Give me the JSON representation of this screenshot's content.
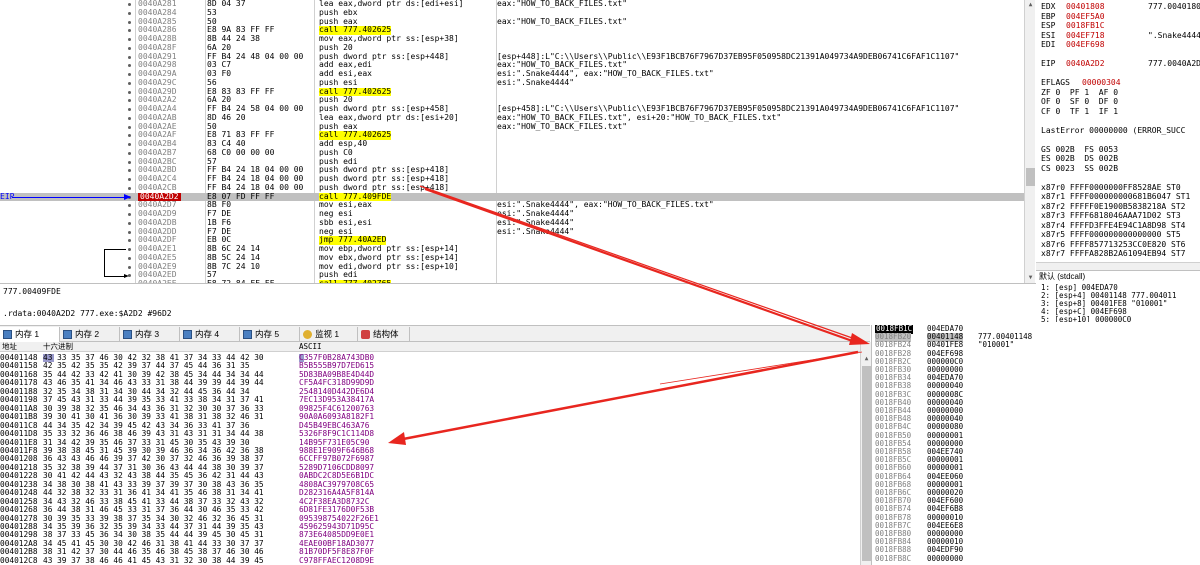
{
  "disasm": {
    "rows": [
      {
        "addr": "0040A281",
        "bytes": "8D 04 37",
        "instr": "lea eax,dword ptr ds:[edi+esi]",
        "cmt": "eax:\"HOW_TO_BACK_FILES.txt\""
      },
      {
        "addr": "0040A284",
        "bytes": "53",
        "instr": "push ebx",
        "cmt": ""
      },
      {
        "addr": "0040A285",
        "bytes": "50",
        "instr": "push eax",
        "cmt": "eax:\"HOW_TO_BACK_FILES.txt\""
      },
      {
        "addr": "0040A286",
        "bytes": "E8 9A 83 FF FF",
        "instr": "call 777.402625",
        "cmt": "",
        "call": true
      },
      {
        "addr": "0040A28B",
        "bytes": "8B 44 24 38",
        "instr": "mov eax,dword ptr ss:[esp+38]",
        "cmt": "",
        "reg": true
      },
      {
        "addr": "0040A28F",
        "bytes": "6A 20",
        "instr": "push 20",
        "cmt": ""
      },
      {
        "addr": "0040A291",
        "bytes": "FF B4 24 48 04 00 00",
        "instr": "push dword ptr ss:[esp+448]",
        "cmt": "[esp+448]:L\"C:\\\\Users\\\\Public\\\\E93F1BCB76F7967D37EB95F050958DC21391A049734A9DEB06741C6FAF1C1107\"",
        "reg": true
      },
      {
        "addr": "0040A298",
        "bytes": "03 C7",
        "instr": "add eax,edi",
        "cmt": "eax:\"HOW_TO_BACK_FILES.txt\""
      },
      {
        "addr": "0040A29A",
        "bytes": "03 F0",
        "instr": "add esi,eax",
        "cmt": "esi:\".Snake4444\", eax:\"HOW_TO_BACK_FILES.txt\""
      },
      {
        "addr": "0040A29C",
        "bytes": "56",
        "instr": "push esi",
        "cmt": "esi:\".Snake4444\""
      },
      {
        "addr": "0040A29D",
        "bytes": "E8 83 83 FF FF",
        "instr": "call 777.402625",
        "cmt": "",
        "call": true
      },
      {
        "addr": "0040A2A2",
        "bytes": "6A 20",
        "instr": "push 20",
        "cmt": ""
      },
      {
        "addr": "0040A2A4",
        "bytes": "FF B4 24 58 04 00 00",
        "instr": "push dword ptr ss:[esp+458]",
        "cmt": "[esp+458]:L\"C:\\\\Users\\\\Public\\\\E93F1BCB76F7967D37EB95F050958DC21391A049734A9DEB06741C6FAF1C1107\"",
        "reg": true
      },
      {
        "addr": "0040A2AB",
        "bytes": "8D 46 20",
        "instr": "lea eax,dword ptr ds:[esi+20]",
        "cmt": "eax:\"HOW_TO_BACK_FILES.txt\", esi+20:\"HOW_TO_BACK_FILES.txt\""
      },
      {
        "addr": "0040A2AE",
        "bytes": "50",
        "instr": "push eax",
        "cmt": "eax:\"HOW_TO_BACK_FILES.txt\""
      },
      {
        "addr": "0040A2AF",
        "bytes": "E8 71 83 FF FF",
        "instr": "call 777.402625",
        "cmt": "",
        "call": true
      },
      {
        "addr": "0040A2B4",
        "bytes": "83 C4 40",
        "instr": "add esp,40",
        "cmt": ""
      },
      {
        "addr": "0040A2B7",
        "bytes": "68 C0 00 00 00",
        "instr": "push C0",
        "cmt": ""
      },
      {
        "addr": "0040A2BC",
        "bytes": "57",
        "instr": "push edi",
        "cmt": ""
      },
      {
        "addr": "0040A2BD",
        "bytes": "FF B4 24 18 04 00 00",
        "instr": "push dword ptr ss:[esp+418]",
        "cmt": "",
        "reg": true
      },
      {
        "addr": "0040A2C4",
        "bytes": "FF B4 24 18 04 00 00",
        "instr": "push dword ptr ss:[esp+418]",
        "cmt": "",
        "reg": true
      },
      {
        "addr": "0040A2CB",
        "bytes": "FF B4 24 18 04 00 00",
        "instr": "push dword ptr ss:[esp+418]",
        "cmt": "",
        "reg": true
      },
      {
        "addr": "0040A2D2",
        "bytes": "E8 07 FD FF FF",
        "instr": "call 777.409FDE",
        "cmt": "",
        "call": true,
        "current": true
      },
      {
        "addr": "0040A2D7",
        "bytes": "8B F0",
        "instr": "mov esi,eax",
        "cmt": "esi:\".Snake4444\", eax:\"HOW_TO_BACK_FILES.txt\""
      },
      {
        "addr": "0040A2D9",
        "bytes": "F7 DE",
        "instr": "neg esi",
        "cmt": "esi:\".Snake4444\""
      },
      {
        "addr": "0040A2DB",
        "bytes": "1B F6",
        "instr": "sbb esi,esi",
        "cmt": "esi:\".Snake4444\""
      },
      {
        "addr": "0040A2DD",
        "bytes": "F7 DE",
        "instr": "neg esi",
        "cmt": "esi:\".Snake4444\""
      },
      {
        "addr": "0040A2DF",
        "bytes": "EB 0C",
        "instr": "jmp 777.40A2ED",
        "cmt": "",
        "jmp": true
      },
      {
        "addr": "0040A2E1",
        "bytes": "8B 6C 24 14",
        "instr": "mov ebp,dword ptr ss:[esp+14]",
        "cmt": "",
        "reg": true
      },
      {
        "addr": "0040A2E5",
        "bytes": "8B 5C 24 14",
        "instr": "mov ebx,dword ptr ss:[esp+14]",
        "cmt": "",
        "reg": true
      },
      {
        "addr": "0040A2E9",
        "bytes": "8B 7C 24 10",
        "instr": "mov edi,dword ptr ss:[esp+10]",
        "cmt": "",
        "reg": true
      },
      {
        "addr": "0040A2ED",
        "bytes": "57",
        "instr": "push edi",
        "cmt": ""
      },
      {
        "addr": "0040A2EE",
        "bytes": "E8 72 84 FF FF",
        "instr": "call 777.402765",
        "cmt": "",
        "call": true
      },
      {
        "addr": "0040A2F3",
        "bytes": "55",
        "instr": "push ebp",
        "cmt": ""
      }
    ],
    "ip_label": "EIP"
  },
  "registers": {
    "lines": [
      {
        "name": "EDX",
        "val": "00401808",
        "extra": "777.0040180"
      },
      {
        "name": "EBP",
        "val": "004EF5A0",
        "extra": ""
      },
      {
        "name": "ESP",
        "val": "0018FB1C",
        "extra": ""
      },
      {
        "name": "ESI",
        "val": "004EF718",
        "extra": "\".Snake4444"
      },
      {
        "name": "EDI",
        "val": "004EF698",
        "extra": ""
      },
      {
        "name": "",
        "val": "",
        "extra": ""
      },
      {
        "name": "EIP",
        "val": "0040A2D2",
        "extra": "777.0040A2D"
      },
      {
        "name": "",
        "val": "",
        "extra": ""
      },
      {
        "name": "EFLAGS",
        "val": "00000304",
        "extra": ""
      },
      {
        "name": "ZF 0  PF 1  AF 0",
        "val": "",
        "extra": ""
      },
      {
        "name": "OF 0  SF 0  DF 0",
        "val": "",
        "extra": ""
      },
      {
        "name": "CF 0  TF 1  IF 1",
        "val": "",
        "extra": ""
      },
      {
        "name": "",
        "val": "",
        "extra": ""
      },
      {
        "name": "LastError 00000000 (ERROR_SUCC",
        "val": "",
        "extra": ""
      },
      {
        "name": "",
        "val": "",
        "extra": ""
      },
      {
        "name": "GS 002B  FS 0053",
        "val": "",
        "extra": ""
      },
      {
        "name": "ES 002B  DS 002B",
        "val": "",
        "extra": ""
      },
      {
        "name": "CS 0023  SS 002B",
        "val": "",
        "extra": ""
      },
      {
        "name": "",
        "val": "",
        "extra": ""
      },
      {
        "name": "x87r0 FFFF0000000FF8528AE ST0",
        "val": "",
        "extra": ""
      },
      {
        "name": "x87r1 FFFF000000000681B6047 ST1",
        "val": "",
        "extra": ""
      },
      {
        "name": "x87r2 FFFFF0E1900B5838218A ST2",
        "val": "",
        "extra": ""
      },
      {
        "name": "x87r3 FFFF6818046AAA71D02 ST3",
        "val": "",
        "extra": ""
      },
      {
        "name": "x87r4 FFFFD3FFE4E94C1A8D98 ST4",
        "val": "",
        "extra": ""
      },
      {
        "name": "x87r5 FFFF000000000000000 ST5",
        "val": "",
        "extra": ""
      },
      {
        "name": "x87r6 FFFF857713253CC0E820 ST6",
        "val": "",
        "extra": ""
      },
      {
        "name": "x87r7 FFFFA828B2A61094EB94 ST7",
        "val": "",
        "extra": ""
      }
    ]
  },
  "callconv": {
    "title": "默认 (stdcall)",
    "lines": [
      "1: [esp] 004EDA70",
      "2: [esp+4] 00401148 777.004011",
      "3: [esp+8] 00401FE8 \"010001\"",
      "4: [esp+C] 004EF698",
      "5: [esp+10] 000000C0"
    ]
  },
  "status": {
    "line1": "777.00409FDE",
    "line2": ".rdata:0040A2D2 777.exe:$A2D2 #96D2"
  },
  "tabs": [
    {
      "label": "内存 1",
      "icon": "memory-icon",
      "active": true
    },
    {
      "label": "内存 2",
      "icon": "memory-icon",
      "active": false
    },
    {
      "label": "内存 3",
      "icon": "memory-icon",
      "active": false
    },
    {
      "label": "内存 4",
      "icon": "memory-icon",
      "active": false
    },
    {
      "label": "内存 5",
      "icon": "memory-icon",
      "active": false
    },
    {
      "label": "监视 1",
      "icon": "watch-icon",
      "active": false
    },
    {
      "label": "结构体",
      "icon": "struct-icon",
      "active": false
    }
  ],
  "dump": {
    "headers": {
      "addr": "地址",
      "hex": "十六进制",
      "ascii": "ASCII"
    },
    "rows": [
      {
        "addr": "00401148",
        "hex": "43 33 35 37 46 30 42 32 38 41 37 34 33 44 42 30",
        "asc": "C357F0B28A743DB0"
      },
      {
        "addr": "00401158",
        "hex": "42 35 42 35 35 42 39 37 44 37 45 44 36 31 35",
        "asc": "B5B555B97D7ED615"
      },
      {
        "addr": "00401168",
        "hex": "35 44 42 33 42 41 30 39 42 38 45 34 44 34 34 44",
        "asc": "5D83BA09B8E4D44D"
      },
      {
        "addr": "00401178",
        "hex": "43 46 35 41 34 46 43 33 31 38 44 39 39 44 39 44",
        "asc": "CF5A4FC318D99D9D"
      },
      {
        "addr": "00401188",
        "hex": "32 35 34 38 31 34 30 44 34 32 44 45 36 44 34",
        "asc": "2548140D442DE6D4"
      },
      {
        "addr": "00401198",
        "addr2": "",
        "hex": "37 45 43 31 33 44 39 35 33 41 33 38 34 31 37 41",
        "asc": "7EC13D953A38417A"
      },
      {
        "addr": "004011A8",
        "hex": "30 39 38 32 35 46 34 43 36 31 32 30 30 37 36 33",
        "asc": "09825F4C61200763"
      },
      {
        "addr": "004011B8",
        "hex": "39 30 41 30 41 36 30 39 33 41 38 31 38 32 46 31",
        "asc": "90A0A6093A8182F1"
      },
      {
        "addr": "004011C8",
        "hex": "44 34 35 42 34 39 45 42 43 34 36 33 41 37 36",
        "asc": "D45B49EBC463A76"
      },
      {
        "addr": "004011D8",
        "hex": "35 33 32 36 46 38 46 39 43 31 43 31 31 34 44 38",
        "asc": "5326F8F9C1C114D8"
      },
      {
        "addr": "004011E8",
        "hex": "31 34 42 39 35 46 37 33 31 45 30 35 43 39 30",
        "asc": "14B95F731E05C90"
      },
      {
        "addr": "004011F8",
        "hex": "39 38 38 45 31 45 39 30 39 46 36 34 36 42 36 38",
        "asc": "988E1E909F646B68"
      },
      {
        "addr": "00401208",
        "hex": "36 43 43 46 46 39 37 42 30 37 32 46 36 39 38 37",
        "asc": "6CCFF97B072F6987"
      },
      {
        "addr": "00401218",
        "hex": "35 32 38 39 44 37 31 30 36 43 44 44 38 30 39 37",
        "asc": "5289D7106CDD8097"
      },
      {
        "addr": "00401228",
        "hex": "30 41 42 44 43 32 43 38 44 35 45 36 42 31 44 43",
        "asc": "0ABDC2C8D5E6B1DC"
      },
      {
        "addr": "00401238",
        "hex": "34 38 30 38 41 43 33 39 37 39 37 30 38 43 36 35",
        "asc": "4808AC3979708C65"
      },
      {
        "addr": "00401248",
        "hex": "44 32 38 32 33 31 36 41 34 41 35 46 38 31 34 41",
        "asc": "D282316A4A5F814A"
      },
      {
        "addr": "00401258",
        "hex": "34 43 32 46 33 38 45 41 33 44 38 37 33 32 43 32",
        "asc": "4C2F38EA3D8732C"
      },
      {
        "addr": "00401268",
        "hex": "36 44 38 31 46 45 33 31 37 36 44 30 46 35 33 42",
        "asc": "6D81FE3176D0F53B"
      },
      {
        "addr": "00401278",
        "hex": "30 39 35 33 39 38 37 35 34 30 32 46 32 36 45 31",
        "asc": "095398754022F26E1"
      },
      {
        "addr": "00401288",
        "hex": "34 35 39 36 32 35 39 34 33 44 37 31 44 39 35 43",
        "asc": "459625943D71D95C"
      },
      {
        "addr": "00401298",
        "hex": "38 37 33 45 36 34 30 38 35 44 44 39 45 30 45 31",
        "asc": "873E64085DD9E0E1"
      },
      {
        "addr": "004012A8",
        "hex": "34 45 41 45 30 30 42 46 31 38 41 44 33 30 37 37",
        "asc": "4EAE00BF18AD3077"
      },
      {
        "addr": "004012B8",
        "hex": "38 31 42 37 30 44 46 35 46 38 45 38 37 46 30 46",
        "asc": "81B70DF5F8E87F0F"
      },
      {
        "addr": "004012C8",
        "hex": "43 39 37 38 46 46 41 45 43 31 32 30 38 44 39 45",
        "asc": "C978FFAEC1208D9E"
      }
    ]
  },
  "stack": {
    "rows": [
      {
        "addr": "0018FB1C",
        "val": "004EDA70",
        "cmt": "",
        "cur": true
      },
      {
        "addr": "0018FB20",
        "val": "00401148",
        "cmt": "777.00401148",
        "sel": true
      },
      {
        "addr": "0018FB24",
        "val": "00401FE8",
        "cmt": "\"010001\""
      },
      {
        "addr": "0018FB28",
        "val": "004EF698",
        "cmt": ""
      },
      {
        "addr": "0018FB2C",
        "val": "000000C0",
        "cmt": ""
      },
      {
        "addr": "0018FB30",
        "val": "00000000",
        "cmt": ""
      },
      {
        "addr": "0018FB34",
        "val": "004EDA70",
        "cmt": ""
      },
      {
        "addr": "0018FB38",
        "val": "00000040",
        "cmt": ""
      },
      {
        "addr": "0018FB3C",
        "val": "0000008C",
        "cmt": ""
      },
      {
        "addr": "0018FB40",
        "val": "00000040",
        "cmt": ""
      },
      {
        "addr": "0018FB44",
        "val": "00000000",
        "cmt": ""
      },
      {
        "addr": "0018FB48",
        "val": "00000040",
        "cmt": ""
      },
      {
        "addr": "0018FB4C",
        "val": "00000080",
        "cmt": ""
      },
      {
        "addr": "0018FB50",
        "val": "00000001",
        "cmt": ""
      },
      {
        "addr": "0018FB54",
        "val": "00000000",
        "cmt": ""
      },
      {
        "addr": "0018FB58",
        "val": "004EE740",
        "cmt": ""
      },
      {
        "addr": "0018FB5C",
        "val": "00000001",
        "cmt": ""
      },
      {
        "addr": "0018FB60",
        "val": "00000001",
        "cmt": ""
      },
      {
        "addr": "0018FB64",
        "val": "004EE060",
        "cmt": ""
      },
      {
        "addr": "0018FB68",
        "val": "00000001",
        "cmt": ""
      },
      {
        "addr": "0018FB6C",
        "val": "00000020",
        "cmt": ""
      },
      {
        "addr": "0018FB70",
        "val": "004EF600",
        "cmt": ""
      },
      {
        "addr": "0018FB74",
        "val": "004EF6B8",
        "cmt": ""
      },
      {
        "addr": "0018FB78",
        "val": "00000010",
        "cmt": ""
      },
      {
        "addr": "0018FB7C",
        "val": "004EE6E8",
        "cmt": ""
      },
      {
        "addr": "0018FB80",
        "val": "00000000",
        "cmt": ""
      },
      {
        "addr": "0018FB84",
        "val": "00000010",
        "cmt": ""
      },
      {
        "addr": "0018FB88",
        "val": "004EDF90",
        "cmt": ""
      },
      {
        "addr": "0018FB8C",
        "val": "00000000",
        "cmt": ""
      }
    ]
  },
  "colors": {
    "arrow": "#e8261f",
    "call_bg": "#ffff00",
    "cur_addr_bg": "#c00000",
    "ip": "#0000ff",
    "ascii": "#800080",
    "reg_hl": "#00ffff"
  }
}
